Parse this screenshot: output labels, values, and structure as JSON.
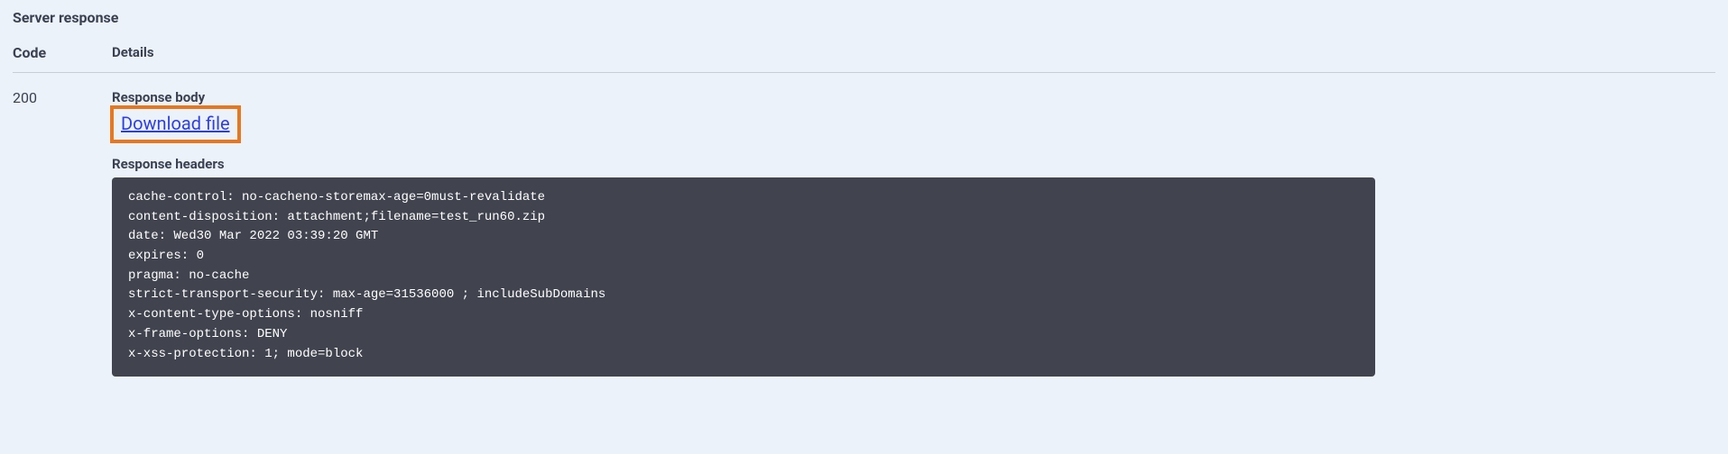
{
  "section_title": "Server response",
  "columns": {
    "code": "Code",
    "details": "Details"
  },
  "response": {
    "code": "200",
    "body_label": "Response body",
    "download_label": "Download file",
    "headers_label": "Response headers",
    "headers_text": "cache-control: no-cacheno-storemax-age=0must-revalidate\ncontent-disposition: attachment;filename=test_run60.zip\ndate: Wed30 Mar 2022 03:39:20 GMT\nexpires: 0\npragma: no-cache\nstrict-transport-security: max-age=31536000 ; includeSubDomains\nx-content-type-options: nosniff\nx-frame-options: DENY\nx-xss-protection: 1; mode=block"
  }
}
